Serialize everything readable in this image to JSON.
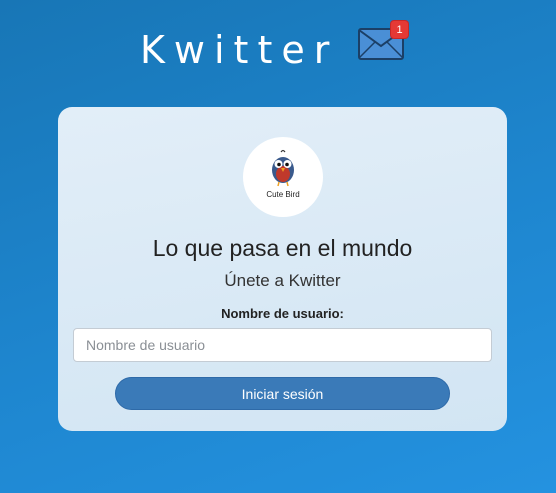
{
  "header": {
    "title": "Kwitter",
    "mail_icon": "envelope-icon",
    "notification_count": "1",
    "badge_color": "#e53935"
  },
  "card": {
    "logo": {
      "icon": "bird-icon",
      "text": "Cute Bird"
    },
    "headline": "Lo que pasa en el mundo",
    "subheadline": "Únete a Kwitter",
    "username_label": "Nombre de usuario:",
    "username_input": {
      "value": "",
      "placeholder": "Nombre de usuario"
    },
    "login_button_label": "Iniciar sesión"
  },
  "colors": {
    "background": "#1e86cf",
    "card": "#d9e9f5",
    "button": "#3a7ab8"
  }
}
